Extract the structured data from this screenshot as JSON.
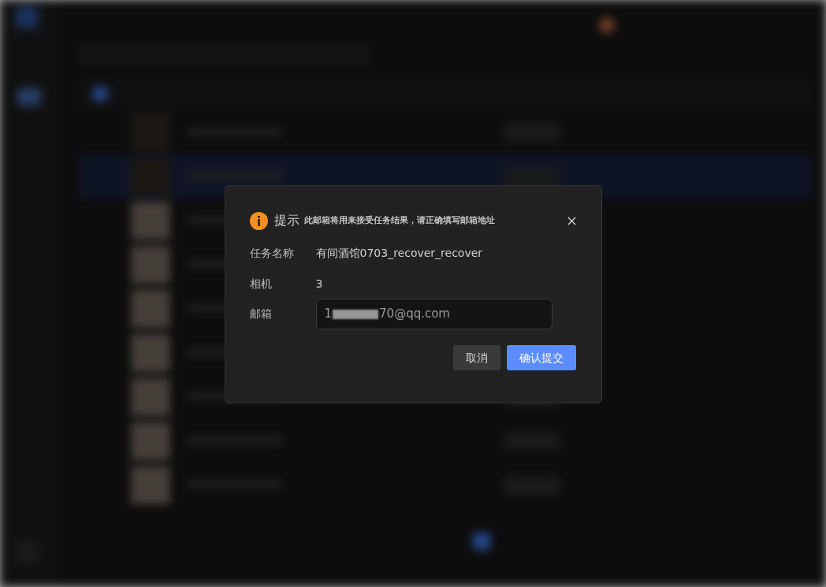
{
  "dialog": {
    "title": "提示",
    "message": "此邮箱将用来接受任务结果，请正确填写邮箱地址",
    "fields": [
      {
        "kind": "text",
        "label": "任务名称",
        "value": "有间酒馆0703_recover_recover"
      },
      {
        "kind": "text",
        "label": "相机",
        "value": "3"
      },
      {
        "kind": "input",
        "label": "邮箱",
        "value_start": "1",
        "redacted": true,
        "value_end": "70@qq.com"
      }
    ],
    "buttons": [
      {
        "kind": "secondary",
        "label": "取消"
      },
      {
        "kind": "primary",
        "label": "确认提交"
      }
    ]
  }
}
